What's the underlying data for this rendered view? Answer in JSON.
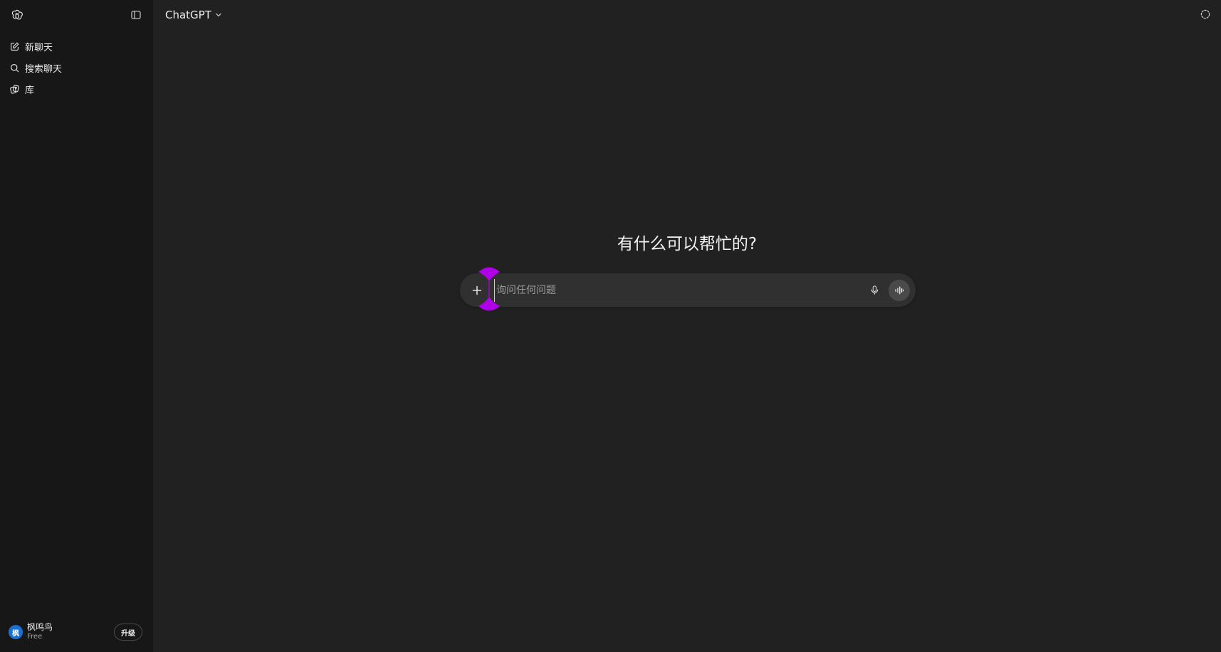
{
  "sidebar": {
    "items": [
      {
        "label": "新聊天",
        "icon": "edit-icon"
      },
      {
        "label": "搜索聊天",
        "icon": "search-icon"
      },
      {
        "label": "库",
        "icon": "library-icon"
      }
    ],
    "user": {
      "avatar_text": "枫",
      "name": "枫鸣鸟",
      "plan": "Free",
      "upgrade_label": "升级"
    }
  },
  "header": {
    "model_label": "ChatGPT"
  },
  "main": {
    "headline": "有什么可以帮忙的?",
    "composer": {
      "placeholder": "询问任何问题",
      "value": ""
    }
  },
  "colors": {
    "sidebar_bg": "#171717",
    "main_bg": "#212121",
    "composer_bg": "#303030",
    "avatar_bg": "#1a6fd1",
    "cursor_handle": "#b000e8"
  }
}
